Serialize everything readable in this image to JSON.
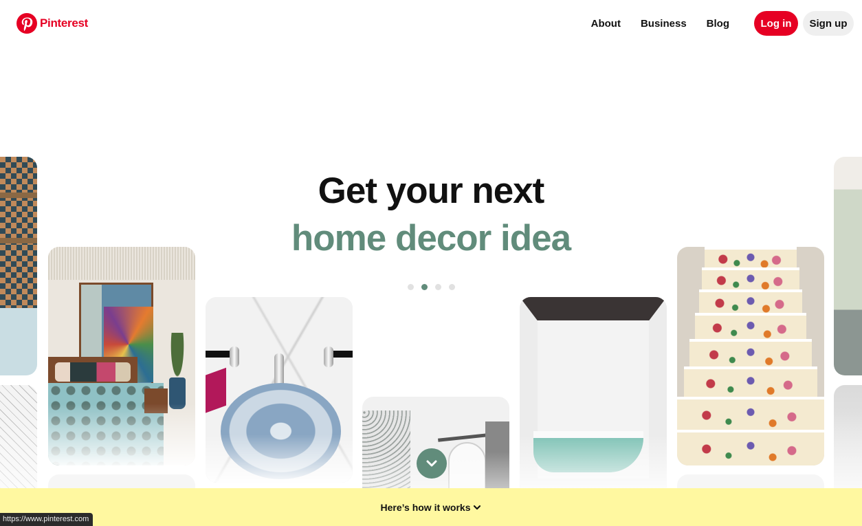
{
  "header": {
    "logo_text": "Pinterest",
    "logo_icon": "pinterest-logo-icon",
    "brand_color": "#e60023",
    "nav": [
      {
        "label": "About"
      },
      {
        "label": "Business"
      },
      {
        "label": "Blog"
      }
    ],
    "login_label": "Log in",
    "signup_label": "Sign up"
  },
  "hero": {
    "line1": "Get your next",
    "line2": "home decor idea",
    "accent_color": "#618c7b",
    "carousel": {
      "count": 4,
      "active_index": 1
    }
  },
  "pins": [
    {
      "subject": "patterned tile kitchen shelves"
    },
    {
      "subject": "black and white pattern wall"
    },
    {
      "subject": "bedroom with painted art panel"
    },
    {
      "subject": "moroccan blue sink"
    },
    {
      "subject": "white room with sliding door"
    },
    {
      "subject": "mint clawfoot bathtub"
    },
    {
      "subject": "floral wallpaper stairs"
    },
    {
      "subject": "arched window living room"
    },
    {
      "subject": "grey interior"
    }
  ],
  "scroll_button": {
    "icon": "chevron-down-icon"
  },
  "band": {
    "label": "Here’s how it works",
    "icon": "chevron-down-icon",
    "color": "#fff8a0"
  },
  "status_bar": {
    "url": "https://www.pinterest.com"
  }
}
